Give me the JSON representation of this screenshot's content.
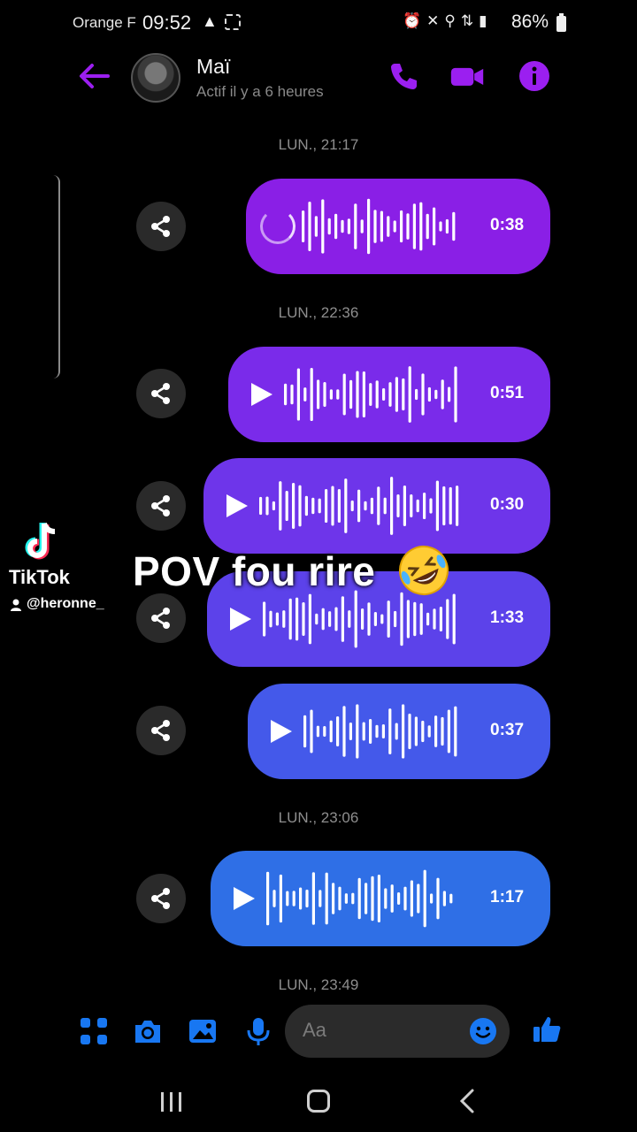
{
  "status_bar": {
    "carrier": "Orange F",
    "time": "09:52",
    "battery": "86%"
  },
  "header": {
    "contact_name": "Maï",
    "contact_status": "Actif il y a 6 heures",
    "icons": [
      "back-arrow-icon",
      "phone-icon",
      "video-camera-icon",
      "info-icon"
    ],
    "accent_color": "#9b1ff0"
  },
  "messages": [
    {
      "stamp": "LUN., 21:17",
      "duration": "0:38",
      "state": "loading"
    },
    {
      "stamp": "LUN., 22:36",
      "duration": "0:51",
      "state": "paused"
    },
    {
      "duration": "0:30",
      "state": "paused"
    },
    {
      "duration": "1:33",
      "state": "paused"
    },
    {
      "duration": "0:37",
      "state": "paused"
    },
    {
      "stamp": "LUN., 23:06",
      "duration": "1:17",
      "state": "paused"
    }
  ],
  "last_stamp": "LUN., 23:49",
  "overlay": {
    "caption": "POV fou rire",
    "emoji_icon": "rolling-on-floor-laughing-emoji",
    "tiktok_brand": "TikTok",
    "tiktok_user": "@heronne_"
  },
  "composer": {
    "placeholder": "Aa",
    "icons": [
      "apps-grid-icon",
      "camera-icon",
      "gallery-icon",
      "microphone-icon",
      "emoji-icon",
      "thumbs-up-icon"
    ],
    "accent_color": "#1877f2"
  }
}
